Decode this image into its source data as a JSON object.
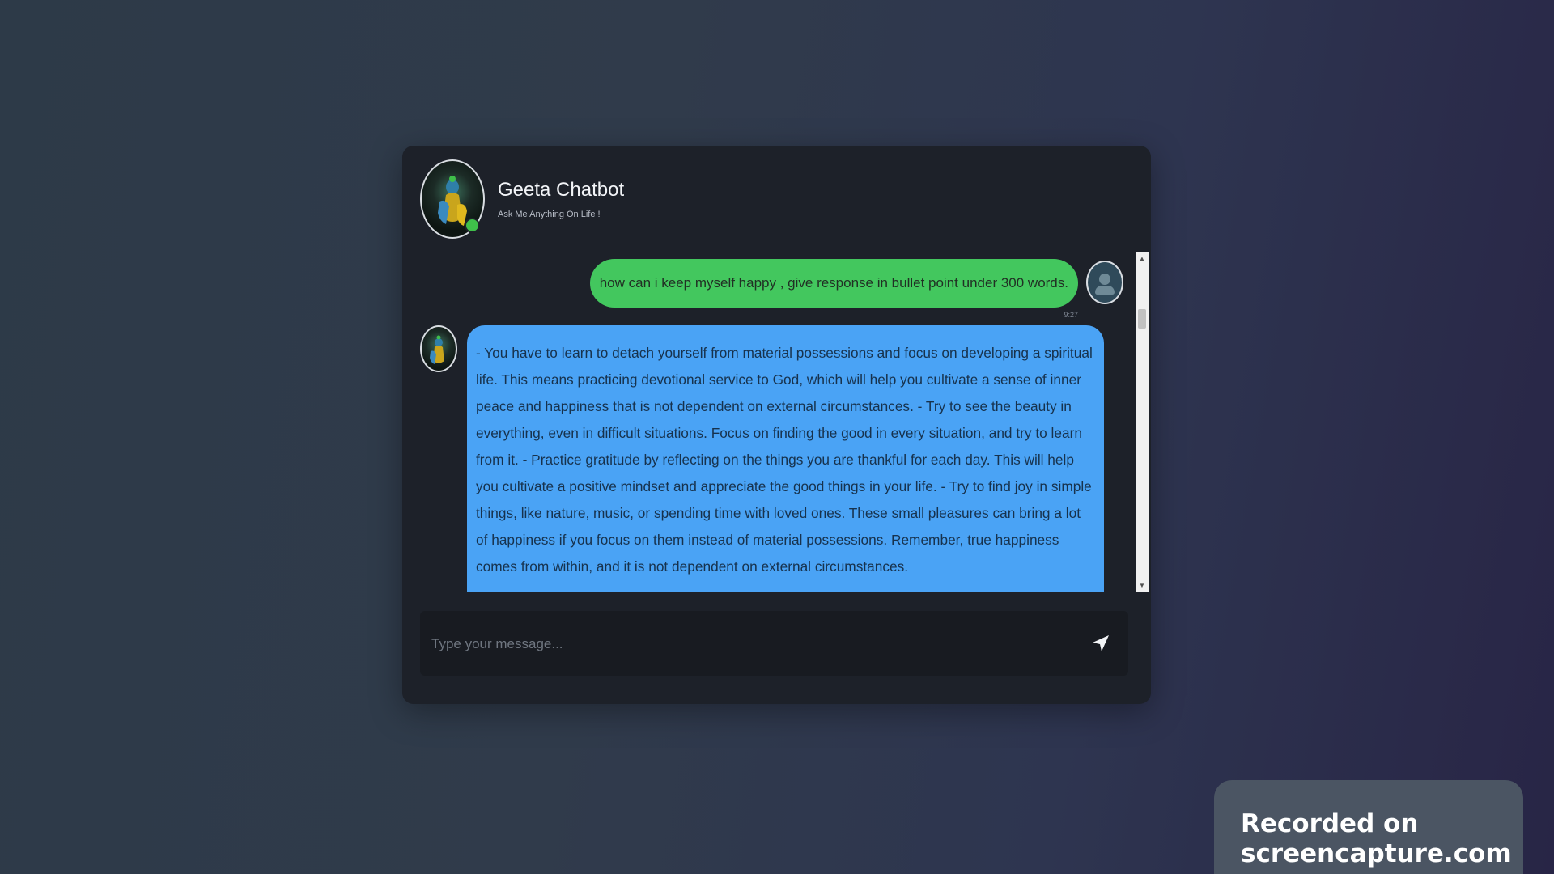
{
  "chat": {
    "bot_name": "Geeta Chatbot",
    "bot_subtitle": "Ask Me Anything On Life !",
    "bot_status": "online",
    "user_message": "how can i keep myself happy , give response in bullet point under 300 words.",
    "user_message_time": "9:27",
    "bot_message": "- You have to learn to detach yourself from material possessions and focus on developing a spiritual life. This means practicing devotional service to God, which will help you cultivate a sense of inner peace and happiness that is not dependent on external circumstances. - Try to see the beauty in everything, even in difficult situations. Focus on finding the good in every situation, and try to learn from it. - Practice gratitude by reflecting on the things you are thankful for each day. This will help you cultivate a positive mindset and appreciate the good things in your life. - Try to find joy in simple things, like nature, music, or spending time with loved ones. These small pleasures can bring a lot of happiness if you focus on them instead of material possessions. Remember, true happiness comes from within, and it is not dependent on external circumstances."
  },
  "input": {
    "placeholder": "Type your message..."
  },
  "icons": {
    "send": "send-icon",
    "scroll_up": "scroll-up-arrow",
    "scroll_down": "scroll-down-arrow"
  },
  "colors": {
    "user_bubble": "#43c75e",
    "bot_bubble": "#4aa3f5",
    "online_dot": "#3fbf4a",
    "card_background": "#1d2129"
  },
  "watermark": {
    "text": "Recorded on screencapture.com"
  }
}
